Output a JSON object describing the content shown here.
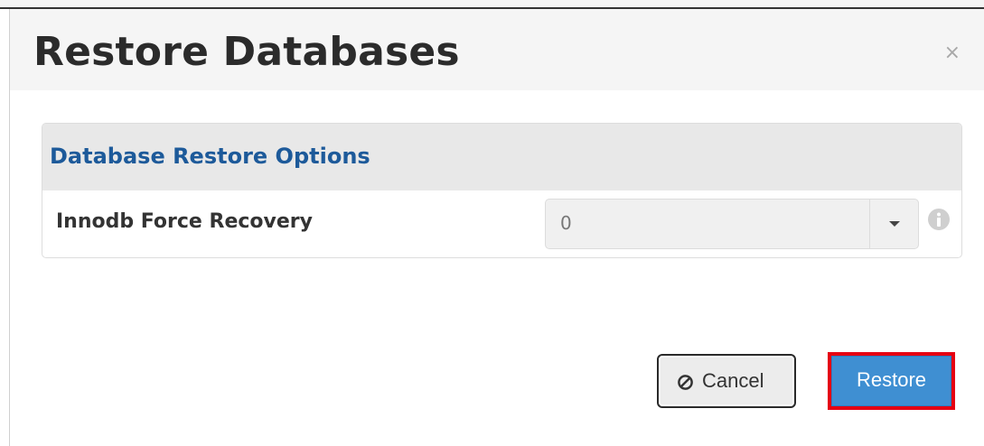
{
  "modal": {
    "title": "Restore Databases",
    "close_symbol": "×"
  },
  "panel": {
    "title": "Database Restore Options",
    "option": {
      "label": "Innodb Force Recovery",
      "selected_value": "0"
    }
  },
  "footer": {
    "cancel_label": "Cancel",
    "restore_label": "Restore"
  },
  "icons": {
    "close": "close-icon",
    "select_arrow": "chevron-down-icon",
    "info": "info-icon",
    "cancel": "ban-icon"
  },
  "colors": {
    "title_text": "#2b2b2b",
    "panel_title": "#1d5a9a",
    "restore_button": "#3f8fd2",
    "highlight": "#e60012",
    "header_bg": "#f5f5f5",
    "panel_heading_bg": "#e8e8e8"
  }
}
